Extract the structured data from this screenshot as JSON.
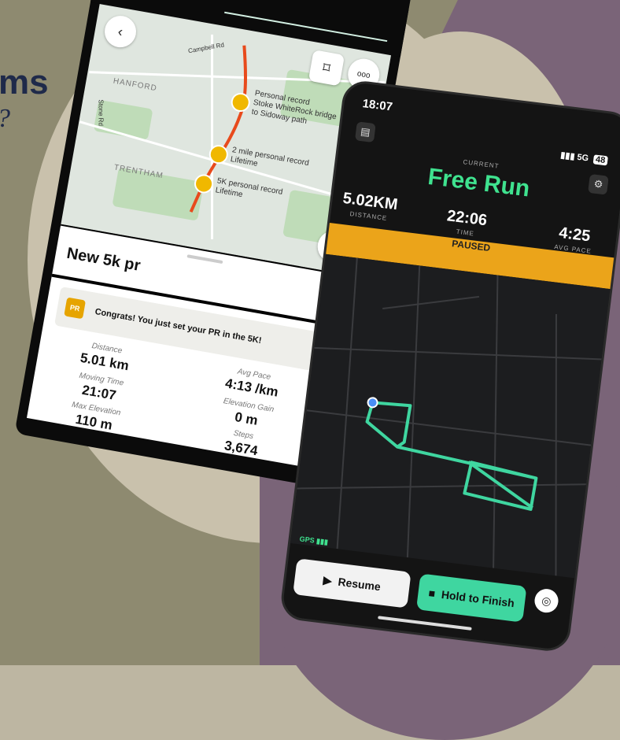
{
  "heading": {
    "title": "ms",
    "subtitle": "?"
  },
  "phone1": {
    "map": {
      "streets": [
        "Campbell Rd",
        "Stone Rd"
      ],
      "towns": [
        "HANFORD",
        "TRENTHAM"
      ],
      "markers": [
        {
          "label": "Personal record\nStoke WhiteRock bridge\nto Sidoway path"
        },
        {
          "label": "2 mile personal record\nLifetime"
        },
        {
          "label": "5K personal record\nLifetime"
        }
      ],
      "buttons": {
        "back": "‹",
        "bookmark": "⌑",
        "more": "ooo",
        "play": "▷"
      }
    },
    "sheet": {
      "title": "New 5k pr",
      "badge": "PR",
      "congrats": "Congrats! You just set your PR in the 5K!",
      "stats": [
        {
          "label": "Distance",
          "value": "5.01 km"
        },
        {
          "label": "Avg Pace",
          "value": "4:13 /km"
        },
        {
          "label": "Moving Time",
          "value": "21:07"
        },
        {
          "label": "Elevation Gain",
          "value": "0 m"
        },
        {
          "label": "Max Elevation",
          "value": "110 m"
        },
        {
          "label": "Steps",
          "value": "3,674"
        }
      ]
    }
  },
  "phone2": {
    "status": {
      "time": "18:07",
      "signal": "5G",
      "battery": "48"
    },
    "current_label": "CURRENT",
    "title": "Free Run",
    "stats": [
      {
        "value": "5.02KM",
        "label": "DISTANCE"
      },
      {
        "value": "22:06",
        "label": "TIME"
      },
      {
        "value": "4:25",
        "label": "AVG PACE"
      }
    ],
    "paused": "PAUSED",
    "gps": "GPS",
    "resume": "Resume",
    "finish": "Hold to Finish",
    "colors": {
      "accent": "#3fe28f",
      "paused": "#eba41a",
      "route": "#3fd6a0"
    }
  }
}
